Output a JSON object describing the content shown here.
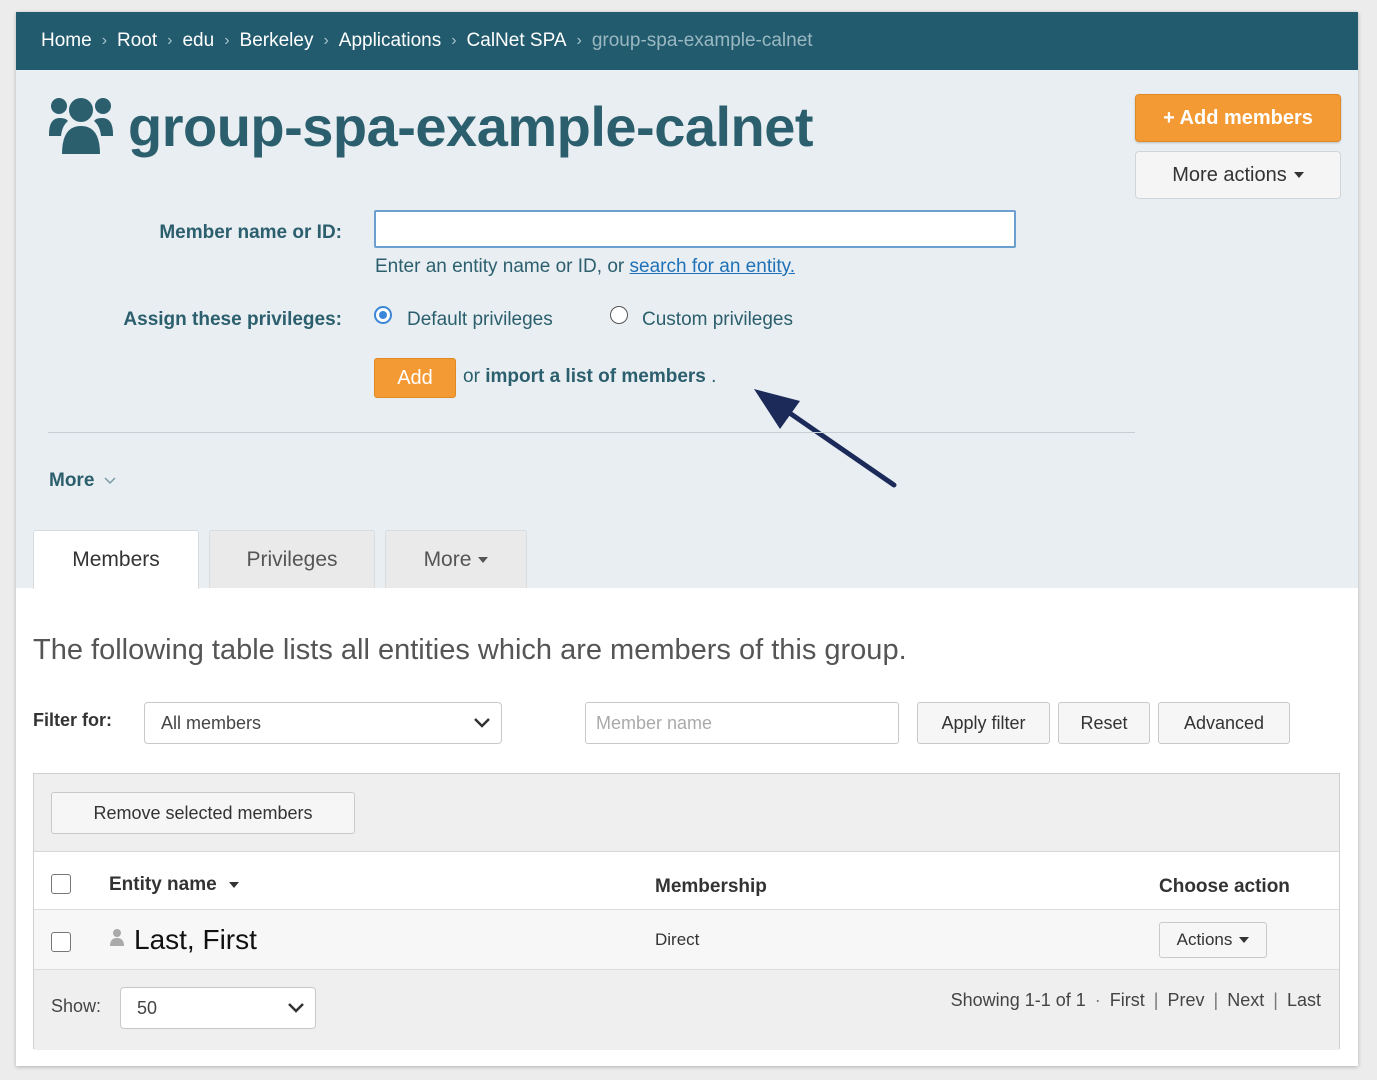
{
  "breadcrumb": {
    "items": [
      "Home",
      "Root",
      "edu",
      "Berkeley",
      "Applications",
      "CalNet SPA"
    ],
    "current": "group-spa-example-calnet"
  },
  "header": {
    "title": "group-spa-example-calnet",
    "add_members_label": "+ Add members",
    "more_actions_label": "More actions"
  },
  "add_form": {
    "member_label": "Member name or ID:",
    "member_value": "",
    "help_prefix": "Enter an entity name or ID, or ",
    "help_link": "search for an entity.",
    "privileges_label": "Assign these privileges:",
    "privilege_options": [
      "Default privileges",
      "Custom privileges"
    ],
    "selected_privilege": "Default privileges",
    "add_label": "Add",
    "import_prefix": "or ",
    "import_link": "import a list of members",
    "import_suffix": " .",
    "more_label": "More"
  },
  "tabs": [
    {
      "label": "Members",
      "active": true
    },
    {
      "label": "Privileges",
      "active": false
    },
    {
      "label": "More",
      "active": false
    }
  ],
  "members": {
    "intro": "The following table lists all entities which are members of this group.",
    "filter_label": "Filter for:",
    "filter_value": "All members",
    "search_placeholder": "Member name",
    "apply_label": "Apply filter",
    "reset_label": "Reset",
    "advanced_label": "Advanced",
    "remove_label": "Remove selected members",
    "columns": [
      "Entity name",
      "Membership",
      "Choose action"
    ],
    "rows": [
      {
        "entity": "Last, First",
        "membership": "Direct",
        "action": "Actions"
      }
    ],
    "show_label": "Show:",
    "page_size": "50",
    "pager_summary": "Showing 1-1 of 1",
    "pager_links": [
      "First",
      "Prev",
      "Next",
      "Last"
    ]
  },
  "colors": {
    "brand_teal": "#225b6e",
    "accent_orange": "#f39a34",
    "header_bg": "#e8eef1",
    "annotation_arrow": "#1c2a5a"
  },
  "icons": {
    "group": "group-icon",
    "person": "person-icon",
    "dropdown": "chevron-down-icon"
  }
}
